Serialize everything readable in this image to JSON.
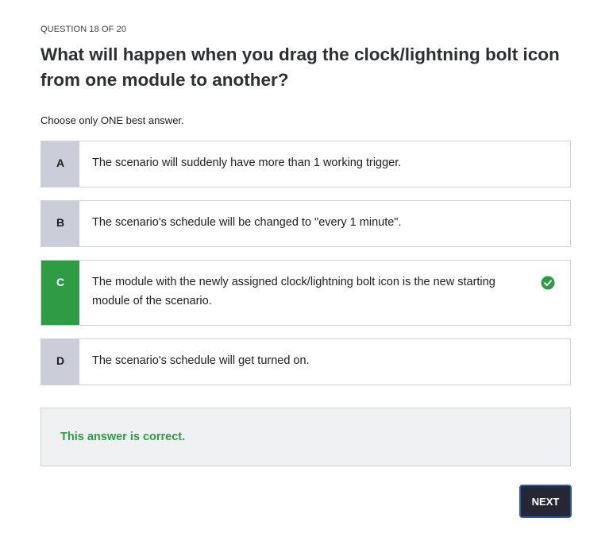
{
  "progress_label": "QUESTION 18 OF 20",
  "question": "What will happen when you drag the clock/lightning bolt icon from one module to another?",
  "instruction": "Choose only ONE best answer.",
  "options": [
    {
      "letter": "A",
      "text": "The scenario will suddenly have more than 1 working trigger.",
      "state": "neutral"
    },
    {
      "letter": "B",
      "text": "The scenario's schedule will be changed to \"every 1 minute\".",
      "state": "neutral"
    },
    {
      "letter": "C",
      "text": "The module with the newly assigned clock/lightning bolt icon is the new starting module of the scenario.",
      "state": "correct"
    },
    {
      "letter": "D",
      "text": "The scenario's schedule will get turned on.",
      "state": "neutral"
    }
  ],
  "feedback": {
    "message": "This answer is correct."
  },
  "next_button_label": "NEXT",
  "colors": {
    "correct": "#2e9c45",
    "letter_bg": "#cbced8",
    "button_bg": "#252734",
    "button_border": "#2b59a8"
  },
  "icons": {
    "correct_mark": "check-circle-icon"
  }
}
